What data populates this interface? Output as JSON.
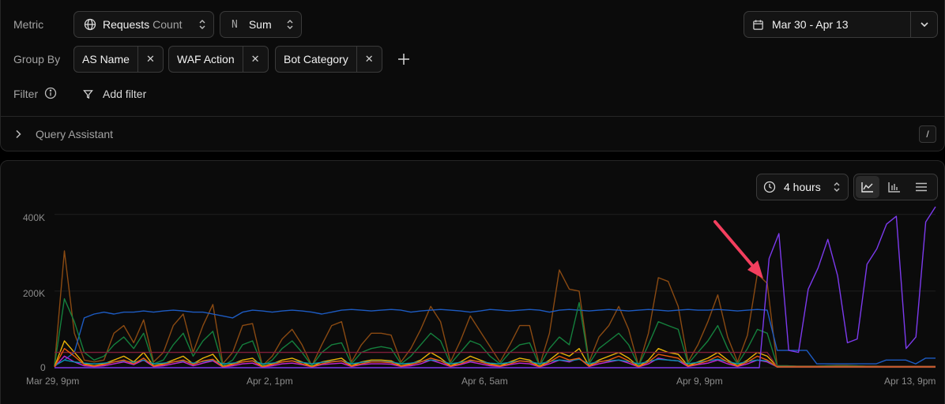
{
  "query": {
    "metric_label": "Metric",
    "metric_name": "Requests",
    "metric_suffix": "Count",
    "agg_prefix": "N",
    "agg_value": "Sum",
    "date_range": "Mar 30 - Apr 13",
    "group_by_label": "Group By",
    "group_chips": [
      "AS Name",
      "WAF Action",
      "Bot Category"
    ],
    "filter_label": "Filter",
    "add_filter_label": "Add filter",
    "assistant_label": "Query Assistant",
    "assistant_shortcut": "/"
  },
  "chart_controls": {
    "interval": "4 hours",
    "view_modes": [
      "line-chart-icon",
      "bar-chart-icon",
      "list-icon"
    ],
    "active_view": "line-chart-icon"
  },
  "colors": {
    "purple": "#7c3aed",
    "blue": "#1d5bc2",
    "brown": "#8a4a12",
    "green": "#15803d",
    "yellow": "#eab308",
    "crimson": "#7f1d3a",
    "pink": "#c026d3",
    "cyan": "#0891b2",
    "orange": "#ea580c",
    "arrow": "#f43f5e"
  },
  "chart_data": {
    "type": "line",
    "yticks": [
      "0",
      "200K",
      "400K"
    ],
    "ylim": [
      0,
      420000
    ],
    "xticks": [
      "Mar 29, 9pm",
      "Apr 2, 1pm",
      "Apr 6, 5am",
      "Apr 9, 9pm",
      "Apr 13, 9pm"
    ],
    "grid": true,
    "legend": "none",
    "annotation": "arrow pointing to the spike start near Apr 11",
    "series": [
      {
        "color_key": "brown",
        "values": [
          5000,
          305000,
          90000,
          20000,
          15000,
          20000,
          90000,
          110000,
          65000,
          125000,
          15000,
          40000,
          110000,
          140000,
          40000,
          110000,
          165000,
          10000,
          40000,
          110000,
          115000,
          5000,
          30000,
          75000,
          100000,
          60000,
          5000,
          60000,
          110000,
          120000,
          15000,
          60000,
          90000,
          90000,
          85000,
          15000,
          50000,
          100000,
          160000,
          120000,
          15000,
          70000,
          135000,
          95000,
          55000,
          15000,
          60000,
          110000,
          110000,
          5000,
          90000,
          255000,
          205000,
          200000,
          15000,
          80000,
          110000,
          160000,
          100000,
          5000,
          90000,
          235000,
          225000,
          160000,
          15000,
          60000,
          120000,
          190000,
          80000,
          15000,
          85000,
          245000,
          220000,
          5000,
          5000,
          4000,
          4000,
          4000,
          5000,
          6000,
          6000,
          5000,
          4000,
          4000,
          3000,
          3000,
          3000,
          3000,
          3000,
          3000
        ]
      },
      {
        "color_key": "blue",
        "values": [
          5000,
          20000,
          40000,
          130000,
          140000,
          145000,
          140000,
          145000,
          145000,
          148000,
          145000,
          148000,
          150000,
          148000,
          145000,
          145000,
          140000,
          135000,
          130000,
          145000,
          150000,
          148000,
          145000,
          148000,
          150000,
          148000,
          145000,
          140000,
          145000,
          150000,
          152000,
          150000,
          148000,
          150000,
          152000,
          150000,
          145000,
          148000,
          150000,
          152000,
          150000,
          148000,
          145000,
          148000,
          152000,
          150000,
          148000,
          150000,
          152000,
          150000,
          145000,
          150000,
          152000,
          150000,
          148000,
          150000,
          152000,
          150000,
          148000,
          150000,
          152000,
          150000,
          148000,
          150000,
          152000,
          150000,
          150000,
          152000,
          150000,
          148000,
          150000,
          152000,
          150000,
          45000,
          45000,
          45000,
          45000,
          10000,
          10000,
          10000,
          10000,
          10000,
          10000,
          10000,
          20000,
          20000,
          20000,
          10000,
          25000,
          25000
        ]
      },
      {
        "color_key": "green",
        "values": [
          5000,
          180000,
          120000,
          40000,
          20000,
          30000,
          60000,
          80000,
          50000,
          90000,
          10000,
          20000,
          60000,
          90000,
          30000,
          70000,
          95000,
          5000,
          20000,
          60000,
          70000,
          5000,
          20000,
          50000,
          70000,
          40000,
          5000,
          40000,
          60000,
          65000,
          10000,
          40000,
          50000,
          55000,
          50000,
          10000,
          30000,
          60000,
          90000,
          70000,
          10000,
          40000,
          70000,
          60000,
          30000,
          10000,
          40000,
          60000,
          65000,
          5000,
          50000,
          80000,
          60000,
          170000,
          10000,
          50000,
          70000,
          90000,
          60000,
          5000,
          60000,
          120000,
          110000,
          100000,
          10000,
          40000,
          70000,
          110000,
          50000,
          10000,
          50000,
          100000,
          90000,
          5000,
          5000,
          4000,
          4000,
          4000,
          5000,
          5000,
          5000,
          5000,
          4000,
          4000,
          3000,
          3000,
          3000,
          3000,
          3000,
          3000
        ]
      },
      {
        "color_key": "yellow",
        "values": [
          3000,
          70000,
          40000,
          10000,
          5000,
          10000,
          20000,
          30000,
          15000,
          40000,
          5000,
          10000,
          20000,
          30000,
          10000,
          25000,
          35000,
          3000,
          10000,
          20000,
          25000,
          3000,
          10000,
          20000,
          25000,
          15000,
          3000,
          15000,
          20000,
          25000,
          5000,
          15000,
          20000,
          20000,
          18000,
          5000,
          10000,
          20000,
          40000,
          25000,
          5000,
          15000,
          30000,
          20000,
          10000,
          5000,
          15000,
          25000,
          20000,
          3000,
          20000,
          40000,
          30000,
          50000,
          5000,
          20000,
          30000,
          40000,
          25000,
          3000,
          20000,
          50000,
          40000,
          35000,
          5000,
          15000,
          25000,
          40000,
          20000,
          5000,
          20000,
          40000,
          30000,
          3000,
          3000,
          3000,
          3000,
          3000,
          3000,
          3000,
          3000,
          3000,
          3000,
          3000,
          3000,
          3000,
          3000,
          3000,
          3000,
          3000
        ]
      },
      {
        "color_key": "crimson",
        "values": [
          40000,
          40000,
          40000,
          40000,
          40000,
          40000,
          40000,
          40000,
          40000,
          40000,
          40000,
          40000,
          40000,
          40000,
          40000,
          40000,
          40000,
          40000,
          40000,
          40000,
          40000,
          40000,
          40000,
          40000,
          40000,
          40000,
          40000,
          40000,
          40000,
          40000,
          40000,
          40000,
          40000,
          40000,
          40000,
          40000,
          40000,
          40000,
          40000,
          40000,
          40000,
          40000,
          40000,
          40000,
          40000,
          40000,
          40000,
          40000,
          40000,
          40000,
          40000,
          40000,
          40000,
          40000,
          40000,
          40000,
          40000,
          40000,
          40000,
          40000,
          40000,
          40000,
          40000,
          40000,
          40000,
          40000,
          40000,
          40000,
          40000,
          40000,
          40000,
          40000,
          40000,
          3000,
          3000,
          3000,
          3000,
          3000,
          3000,
          3000,
          3000,
          3000,
          3000,
          3000,
          3000,
          3000,
          3000,
          3000,
          3000,
          3000
        ]
      },
      {
        "color_key": "pink",
        "values": [
          2000,
          30000,
          15000,
          5000,
          3000,
          5000,
          10000,
          15000,
          8000,
          20000,
          3000,
          5000,
          10000,
          15000,
          5000,
          12000,
          18000,
          2000,
          5000,
          10000,
          12000,
          2000,
          5000,
          10000,
          12000,
          8000,
          2000,
          8000,
          10000,
          12000,
          3000,
          8000,
          10000,
          10000,
          9000,
          3000,
          5000,
          10000,
          20000,
          12000,
          3000,
          8000,
          15000,
          10000,
          5000,
          3000,
          8000,
          12000,
          10000,
          2000,
          10000,
          20000,
          15000,
          25000,
          3000,
          10000,
          15000,
          20000,
          12000,
          2000,
          10000,
          25000,
          20000,
          18000,
          3000,
          8000,
          12000,
          20000,
          10000,
          3000,
          10000,
          20000,
          15000,
          2000,
          2000,
          2000,
          2000,
          2000,
          2000,
          2000,
          2000,
          2000,
          2000,
          2000,
          2000,
          2000,
          2000,
          2000,
          2000,
          2000
        ]
      },
      {
        "color_key": "cyan",
        "values": [
          5000,
          20000,
          15000,
          12000,
          10000,
          12000,
          15000,
          18000,
          14000,
          20000,
          10000,
          12000,
          15000,
          18000,
          12000,
          16000,
          20000,
          10000,
          12000,
          15000,
          18000,
          10000,
          12000,
          15000,
          18000,
          14000,
          10000,
          14000,
          16000,
          18000,
          10000,
          14000,
          16000,
          16000,
          15000,
          10000,
          12000,
          16000,
          20000,
          18000,
          10000,
          14000,
          18000,
          16000,
          12000,
          10000,
          14000,
          18000,
          16000,
          10000,
          16000,
          20000,
          18000,
          22000,
          10000,
          16000,
          18000,
          20000,
          16000,
          10000,
          16000,
          22000,
          20000,
          18000,
          10000,
          14000,
          18000,
          22000,
          16000,
          10000,
          16000,
          20000,
          18000,
          2000,
          2000,
          2000,
          2000,
          2000,
          2000,
          2000,
          2000,
          2000,
          2000,
          2000,
          2000,
          2000,
          2000,
          2000,
          2000,
          2000
        ]
      },
      {
        "color_key": "orange",
        "values": [
          2000,
          50000,
          30000,
          8000,
          4000,
          8000,
          15000,
          20000,
          10000,
          25000,
          4000,
          8000,
          15000,
          20000,
          8000,
          18000,
          22000,
          2000,
          8000,
          15000,
          18000,
          2000,
          8000,
          15000,
          18000,
          10000,
          2000,
          10000,
          15000,
          18000,
          4000,
          10000,
          15000,
          15000,
          13000,
          4000,
          8000,
          15000,
          25000,
          18000,
          4000,
          10000,
          20000,
          15000,
          8000,
          4000,
          10000,
          18000,
          15000,
          2000,
          15000,
          30000,
          20000,
          25000,
          4000,
          15000,
          20000,
          30000,
          18000,
          2000,
          15000,
          35000,
          30000,
          25000,
          4000,
          10000,
          18000,
          30000,
          15000,
          4000,
          15000,
          30000,
          20000,
          2000,
          2000,
          2000,
          2000,
          2000,
          2000,
          2000,
          2000,
          2000,
          2000,
          2000,
          2000,
          2000,
          2000,
          2000,
          2000,
          2000
        ]
      },
      {
        "color_key": "purple",
        "values": [
          0,
          0,
          0,
          0,
          0,
          0,
          0,
          0,
          0,
          0,
          0,
          0,
          0,
          0,
          0,
          0,
          0,
          0,
          0,
          0,
          0,
          0,
          0,
          0,
          0,
          0,
          0,
          0,
          0,
          0,
          0,
          0,
          0,
          0,
          0,
          0,
          0,
          0,
          0,
          0,
          0,
          0,
          0,
          0,
          0,
          0,
          0,
          0,
          0,
          0,
          0,
          0,
          0,
          0,
          0,
          0,
          0,
          0,
          0,
          0,
          0,
          0,
          0,
          0,
          0,
          0,
          0,
          0,
          0,
          0,
          0,
          0,
          0,
          285000,
          350000,
          45000,
          40000,
          205000,
          260000,
          335000,
          240000,
          65000,
          75000,
          270000,
          310000,
          375000,
          395000,
          50000,
          80000,
          380000,
          420000
        ]
      }
    ]
  }
}
